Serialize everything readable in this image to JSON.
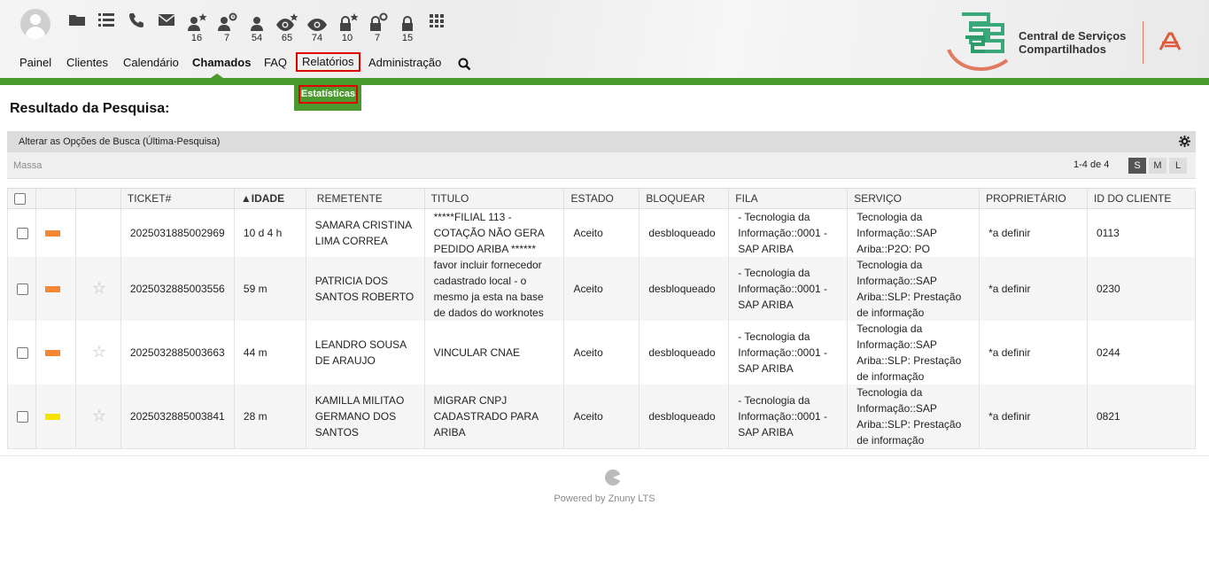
{
  "toolbar": {
    "icons": [
      {
        "name": "new-phone-ticket-icon"
      },
      {
        "name": "queue-view-icon"
      },
      {
        "name": "phone-icon"
      },
      {
        "name": "email-icon"
      },
      {
        "name": "responsible-new-icon",
        "count": "16"
      },
      {
        "name": "responsible-reached-icon",
        "count": "7"
      },
      {
        "name": "responsible-total-icon",
        "count": "54"
      },
      {
        "name": "watched-new-icon",
        "count": "65"
      },
      {
        "name": "watched-total-icon",
        "count": "74"
      },
      {
        "name": "locked-new-icon",
        "count": "10"
      },
      {
        "name": "locked-reached-icon",
        "count": "7"
      },
      {
        "name": "locked-total-icon",
        "count": "15"
      },
      {
        "name": "apps-grid-icon"
      }
    ]
  },
  "nav": {
    "items": [
      "Painel",
      "Clientes",
      "Calendário",
      "Chamados",
      "FAQ",
      "Relatórios",
      "Administração"
    ],
    "active": "Chamados",
    "submenu": "Estatísticas"
  },
  "brand": {
    "line1": "Central de Serviços",
    "line2": "Compartilhados",
    "accent": "#4a9a2e"
  },
  "page": {
    "title": "Resultado da Pesquisa:",
    "search_options": "Alterar as Opções de Busca (Última-Pesquisa)",
    "bulk": "Massa",
    "pagination": "1-4 de 4",
    "sizes": [
      "S",
      "M",
      "L"
    ]
  },
  "table": {
    "columns": [
      "TICKET#",
      "▲IDADE",
      "REMETENTE",
      "TITULO",
      "ESTADO",
      "BLOQUEAR",
      "FILA",
      "SERVIÇO",
      "PROPRIETÁRIO",
      "ID DO CLIENTE"
    ],
    "rows": [
      {
        "priority_color": "#f58634",
        "starred": false,
        "ticket": "2025031885002969",
        "age": "10 d 4 h",
        "sender": "SAMARA CRISTINA LIMA CORREA",
        "title": "*****FILIAL 113 - COTAÇÃO NÃO GERA PEDIDO ARIBA ******",
        "state": "Aceito",
        "lock": "desbloqueado",
        "queue": "- Tecnologia da Informação::0001 - SAP ARIBA",
        "service": "Tecnologia da Informação::SAP Ariba::P2O: PO",
        "owner": "*a definir",
        "customer": "0113"
      },
      {
        "priority_color": "#f58634",
        "starred": true,
        "ticket": "2025032885003556",
        "age": "59 m",
        "sender": "PATRICIA DOS SANTOS ROBERTO",
        "title": "favor incluir fornecedor cadastrado local - o mesmo ja esta na base de dados do worknotes",
        "state": "Aceito",
        "lock": "desbloqueado",
        "queue": "- Tecnologia da Informação::0001 - SAP ARIBA",
        "service": "Tecnologia da Informação::SAP Ariba::SLP: Prestação de informação",
        "owner": "*a definir",
        "customer": "0230"
      },
      {
        "priority_color": "#f58634",
        "starred": true,
        "ticket": "2025032885003663",
        "age": "44 m",
        "sender": "LEANDRO SOUSA DE ARAUJO",
        "title": "VINCULAR CNAE",
        "state": "Aceito",
        "lock": "desbloqueado",
        "queue": "- Tecnologia da Informação::0001 - SAP ARIBA",
        "service": "Tecnologia da Informação::SAP Ariba::SLP: Prestação de informação",
        "owner": "*a definir",
        "customer": "0244"
      },
      {
        "priority_color": "#f5e400",
        "starred": true,
        "ticket": "2025032885003841",
        "age": "28 m",
        "sender": "KAMILLA MILITAO GERMANO DOS SANTOS",
        "title": "MIGRAR CNPJ CADASTRADO PARA ARIBA",
        "state": "Aceito",
        "lock": "desbloqueado",
        "queue": "- Tecnologia da Informação::0001 - SAP ARIBA",
        "service": "Tecnologia da Informação::SAP Ariba::SLP: Prestação de informação",
        "owner": "*a definir",
        "customer": "0821"
      }
    ]
  },
  "footer": {
    "powered_by": "Powered by Znuny LTS"
  }
}
